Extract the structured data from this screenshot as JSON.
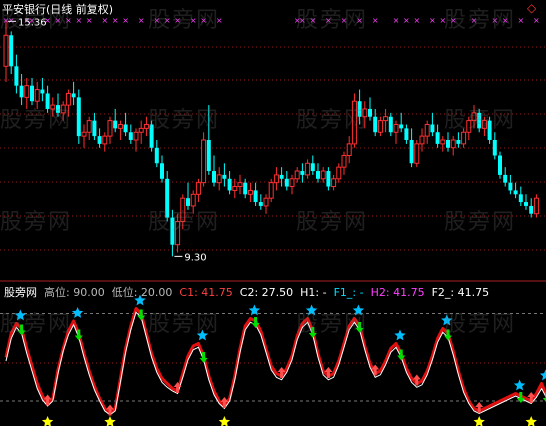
{
  "upper_panel": {
    "title": "平安银行(日线 前复权)",
    "max_label": "15.36",
    "min_label": "9.30",
    "corner_marker": "◇"
  },
  "lower_panel": {
    "indicator_name": "股旁网",
    "legend": [
      {
        "key": "high",
        "text": "高位: 90.00",
        "color": "#b8b8b8"
      },
      {
        "key": "low",
        "text": "低位: 20.00",
        "color": "#b8b8b8"
      },
      {
        "key": "c1",
        "text": "C1: 41.75",
        "color": "#ff4040"
      },
      {
        "key": "c2",
        "text": "C2: 27.50",
        "color": "#ffffff"
      },
      {
        "key": "h1",
        "text": "H1: -",
        "color": "#ffffff"
      },
      {
        "key": "f1",
        "text": "F1_: -",
        "color": "#00e0ff"
      },
      {
        "key": "h2",
        "text": "H2: 41.75",
        "color": "#ff40ff"
      },
      {
        "key": "f2",
        "text": "F2_: 41.75",
        "color": "#ffffff"
      }
    ]
  },
  "watermark": "股旁网",
  "colors": {
    "up": "#ff3030",
    "down": "#00ffff",
    "grid": "#9a1818",
    "signal": "#ff40ff",
    "osc_red": "#e01010",
    "osc_white": "#ffffff",
    "star_cyan": "#00bfff",
    "star_yellow": "#ffff00",
    "arrow_green": "#00e000",
    "arrow_red": "#ff5050"
  },
  "chart_data": [
    {
      "type": "candlestick",
      "title": "平安银行(日线 前复权)",
      "ylim": [
        9.0,
        15.6
      ],
      "annotations": [
        {
          "label": "15.36",
          "value": 15.36,
          "kind": "max"
        },
        {
          "label": "9.30",
          "value": 9.3,
          "kind": "min"
        }
      ],
      "ohlc": [
        [
          14.2,
          15.36,
          13.8,
          15.0
        ],
        [
          15.0,
          15.1,
          14.0,
          14.2
        ],
        [
          14.2,
          14.5,
          13.5,
          13.7
        ],
        [
          13.7,
          14.0,
          13.2,
          13.4
        ],
        [
          13.4,
          13.9,
          13.1,
          13.7
        ],
        [
          13.7,
          13.9,
          13.2,
          13.3
        ],
        [
          13.3,
          13.8,
          13.1,
          13.6
        ],
        [
          13.6,
          13.9,
          13.3,
          13.5
        ],
        [
          13.5,
          13.7,
          13.0,
          13.1
        ],
        [
          13.1,
          13.4,
          12.9,
          13.2
        ],
        [
          13.2,
          13.5,
          12.9,
          13.0
        ],
        [
          13.0,
          13.3,
          12.8,
          13.2
        ],
        [
          13.2,
          13.6,
          12.9,
          13.5
        ],
        [
          13.5,
          13.8,
          13.2,
          13.4
        ],
        [
          13.4,
          13.6,
          12.2,
          12.4
        ],
        [
          12.4,
          12.7,
          12.1,
          12.5
        ],
        [
          12.5,
          12.9,
          12.3,
          12.8
        ],
        [
          12.8,
          13.0,
          12.3,
          12.4
        ],
        [
          12.4,
          12.6,
          12.1,
          12.2
        ],
        [
          12.2,
          12.5,
          12.0,
          12.4
        ],
        [
          12.4,
          12.9,
          12.2,
          12.8
        ],
        [
          12.8,
          13.1,
          12.5,
          12.6
        ],
        [
          12.6,
          12.8,
          12.3,
          12.7
        ],
        [
          12.7,
          13.0,
          12.4,
          12.5
        ],
        [
          12.5,
          12.7,
          12.2,
          12.3
        ],
        [
          12.3,
          12.6,
          12.0,
          12.5
        ],
        [
          12.5,
          12.8,
          12.2,
          12.6
        ],
        [
          12.6,
          12.9,
          12.4,
          12.7
        ],
        [
          12.7,
          12.8,
          12.0,
          12.1
        ],
        [
          12.1,
          12.3,
          11.6,
          11.7
        ],
        [
          11.7,
          11.9,
          11.2,
          11.3
        ],
        [
          11.3,
          11.5,
          10.2,
          10.3
        ],
        [
          10.3,
          10.5,
          9.3,
          9.6
        ],
        [
          9.6,
          10.4,
          9.4,
          10.2
        ],
        [
          10.2,
          10.9,
          10.0,
          10.8
        ],
        [
          10.8,
          11.2,
          10.5,
          10.6
        ],
        [
          10.6,
          11.0,
          10.4,
          10.9
        ],
        [
          10.9,
          11.3,
          10.7,
          11.2
        ],
        [
          11.2,
          12.5,
          11.1,
          12.3
        ],
        [
          12.3,
          13.2,
          11.4,
          11.5
        ],
        [
          11.5,
          11.9,
          11.1,
          11.2
        ],
        [
          11.2,
          11.6,
          11.0,
          11.4
        ],
        [
          11.4,
          11.7,
          11.1,
          11.3
        ],
        [
          11.3,
          11.5,
          10.9,
          11.0
        ],
        [
          11.0,
          11.3,
          10.8,
          11.1
        ],
        [
          11.1,
          11.4,
          10.9,
          11.2
        ],
        [
          11.2,
          11.3,
          10.8,
          10.9
        ],
        [
          10.9,
          11.2,
          10.7,
          11.0
        ],
        [
          11.0,
          11.2,
          10.6,
          10.7
        ],
        [
          10.7,
          10.9,
          10.5,
          10.6
        ],
        [
          10.6,
          10.9,
          10.4,
          10.8
        ],
        [
          10.8,
          11.3,
          10.7,
          11.2
        ],
        [
          11.2,
          11.6,
          11.0,
          11.4
        ],
        [
          11.4,
          11.6,
          11.1,
          11.3
        ],
        [
          11.3,
          11.5,
          11.0,
          11.1
        ],
        [
          11.1,
          11.4,
          10.9,
          11.3
        ],
        [
          11.3,
          11.6,
          11.2,
          11.5
        ],
        [
          11.5,
          11.7,
          11.2,
          11.4
        ],
        [
          11.4,
          11.8,
          11.3,
          11.7
        ],
        [
          11.7,
          11.9,
          11.4,
          11.5
        ],
        [
          11.5,
          11.7,
          11.2,
          11.3
        ],
        [
          11.3,
          11.6,
          11.2,
          11.5
        ],
        [
          11.5,
          11.6,
          11.0,
          11.1
        ],
        [
          11.1,
          11.4,
          11.0,
          11.3
        ],
        [
          11.3,
          11.7,
          11.2,
          11.6
        ],
        [
          11.6,
          12.0,
          11.4,
          11.9
        ],
        [
          11.9,
          12.4,
          11.7,
          12.2
        ],
        [
          12.2,
          13.5,
          12.1,
          13.3
        ],
        [
          13.3,
          13.6,
          12.7,
          12.9
        ],
        [
          12.9,
          13.3,
          12.6,
          13.1
        ],
        [
          13.1,
          13.4,
          12.8,
          12.9
        ],
        [
          12.9,
          13.1,
          12.4,
          12.5
        ],
        [
          12.5,
          12.9,
          12.4,
          12.8
        ],
        [
          12.8,
          13.1,
          12.5,
          12.9
        ],
        [
          12.9,
          13.0,
          12.4,
          12.5
        ],
        [
          12.5,
          12.8,
          12.2,
          12.7
        ],
        [
          12.7,
          13.0,
          12.5,
          12.6
        ],
        [
          12.6,
          12.7,
          12.2,
          12.3
        ],
        [
          12.3,
          12.6,
          11.6,
          11.7
        ],
        [
          11.7,
          12.3,
          11.6,
          12.2
        ],
        [
          12.2,
          12.6,
          12.0,
          12.4
        ],
        [
          12.4,
          12.8,
          12.2,
          12.7
        ],
        [
          12.7,
          13.0,
          12.4,
          12.5
        ],
        [
          12.5,
          12.7,
          12.1,
          12.2
        ],
        [
          12.2,
          12.4,
          12.0,
          12.3
        ],
        [
          12.3,
          12.5,
          12.0,
          12.1
        ],
        [
          12.1,
          12.4,
          11.9,
          12.3
        ],
        [
          12.3,
          12.5,
          12.1,
          12.2
        ],
        [
          12.2,
          12.6,
          12.1,
          12.5
        ],
        [
          12.5,
          12.9,
          12.3,
          12.8
        ],
        [
          12.8,
          13.2,
          12.6,
          13.0
        ],
        [
          13.0,
          13.1,
          12.5,
          12.6
        ],
        [
          12.6,
          12.9,
          12.4,
          12.8
        ],
        [
          12.8,
          12.9,
          12.2,
          12.3
        ],
        [
          12.3,
          12.5,
          11.8,
          11.9
        ],
        [
          11.9,
          12.0,
          11.3,
          11.4
        ],
        [
          11.4,
          11.6,
          11.1,
          11.2
        ],
        [
          11.2,
          11.4,
          10.9,
          11.0
        ],
        [
          11.0,
          11.2,
          10.8,
          10.9
        ],
        [
          10.9,
          11.1,
          10.6,
          10.7
        ],
        [
          10.7,
          10.9,
          10.5,
          10.6
        ],
        [
          10.6,
          10.8,
          10.3,
          10.4
        ],
        [
          10.4,
          10.9,
          10.3,
          10.8
        ]
      ],
      "signal_marks": [
        0,
        1,
        4,
        5,
        8,
        10,
        12,
        14,
        16,
        19,
        21,
        23,
        26,
        29,
        31,
        33,
        36,
        38,
        41,
        56,
        57,
        59,
        62,
        65,
        68,
        71,
        75,
        77,
        79,
        82,
        84,
        86,
        90,
        94,
        96,
        99,
        102
      ]
    },
    {
      "type": "line",
      "title": "股旁网",
      "ylim": [
        0,
        100
      ],
      "reference_lines": [
        90,
        20
      ],
      "series": [
        {
          "key": "c1",
          "values": [
            55,
            74,
            82,
            78,
            62,
            48,
            34,
            24,
            18,
            22,
            45,
            62,
            76,
            84,
            74,
            58,
            44,
            32,
            22,
            14,
            10,
            14,
            38,
            62,
            80,
            94,
            90,
            74,
            58,
            46,
            38,
            34,
            30,
            28,
            42,
            56,
            64,
            66,
            56,
            40,
            28,
            20,
            16,
            22,
            40,
            62,
            80,
            86,
            84,
            76,
            62,
            48,
            42,
            40,
            46,
            56,
            72,
            82,
            86,
            76,
            58,
            44,
            40,
            42,
            52,
            66,
            80,
            86,
            80,
            64,
            50,
            42,
            44,
            52,
            62,
            66,
            58,
            46,
            38,
            34,
            36,
            44,
            56,
            70,
            78,
            74,
            60,
            44,
            30,
            20,
            14,
            12,
            14,
            16,
            18,
            20,
            22,
            24,
            26,
            24,
            22,
            20,
            26,
            34,
            24
          ]
        },
        {
          "key": "c2",
          "values": [
            52,
            70,
            79,
            74,
            58,
            44,
            30,
            21,
            16,
            20,
            42,
            60,
            73,
            81,
            71,
            55,
            41,
            29,
            20,
            12,
            9,
            12,
            35,
            59,
            77,
            91,
            87,
            71,
            55,
            43,
            35,
            31,
            28,
            26,
            39,
            53,
            61,
            63,
            53,
            37,
            25,
            18,
            14,
            20,
            37,
            59,
            77,
            83,
            81,
            73,
            59,
            45,
            39,
            37,
            43,
            53,
            69,
            79,
            83,
            73,
            55,
            41,
            37,
            39,
            49,
            63,
            77,
            83,
            77,
            61,
            47,
            39,
            41,
            49,
            59,
            63,
            55,
            43,
            35,
            31,
            33,
            41,
            53,
            67,
            75,
            71,
            57,
            41,
            27,
            18,
            12,
            10,
            12,
            14,
            16,
            18,
            20,
            22,
            24,
            22,
            20,
            18,
            23,
            30,
            22
          ]
        }
      ]
    }
  ]
}
